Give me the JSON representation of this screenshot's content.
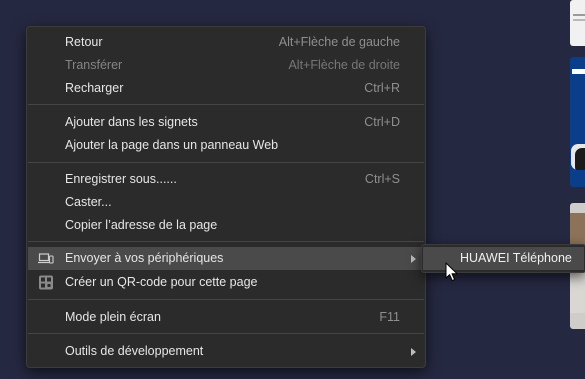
{
  "menu": {
    "back": {
      "label": "Retour",
      "shortcut": "Alt+Flèche de gauche"
    },
    "forward": {
      "label": "Transférer",
      "shortcut": "Alt+Flèche de droite"
    },
    "reload": {
      "label": "Recharger",
      "shortcut": "Ctrl+R"
    },
    "bookmark": {
      "label": "Ajouter dans les signets",
      "shortcut": "Ctrl+D"
    },
    "web_panel": {
      "label": "Ajouter la page dans un panneau Web"
    },
    "save_as": {
      "label": "Enregistrer sous......",
      "shortcut": "Ctrl+S"
    },
    "cast": {
      "label": "Caster..."
    },
    "copy_address": {
      "label": "Copier l’adresse de la page"
    },
    "send_to_devices": {
      "label": "Envoyer à vos périphériques",
      "icon": "laptop-phone-icon"
    },
    "qr_code": {
      "label": "Créer un QR-code pour cette page",
      "icon": "qr-code-icon"
    },
    "fullscreen": {
      "label": "Mode plein écran",
      "shortcut": "F11"
    },
    "dev_tools": {
      "label": "Outils de développement"
    }
  },
  "submenu": {
    "device": {
      "label": "HUAWEI Téléphone"
    }
  },
  "colors": {
    "menu_background": "#2b2b2b",
    "highlight": "#4a4a4a",
    "page_background": "#252841"
  }
}
